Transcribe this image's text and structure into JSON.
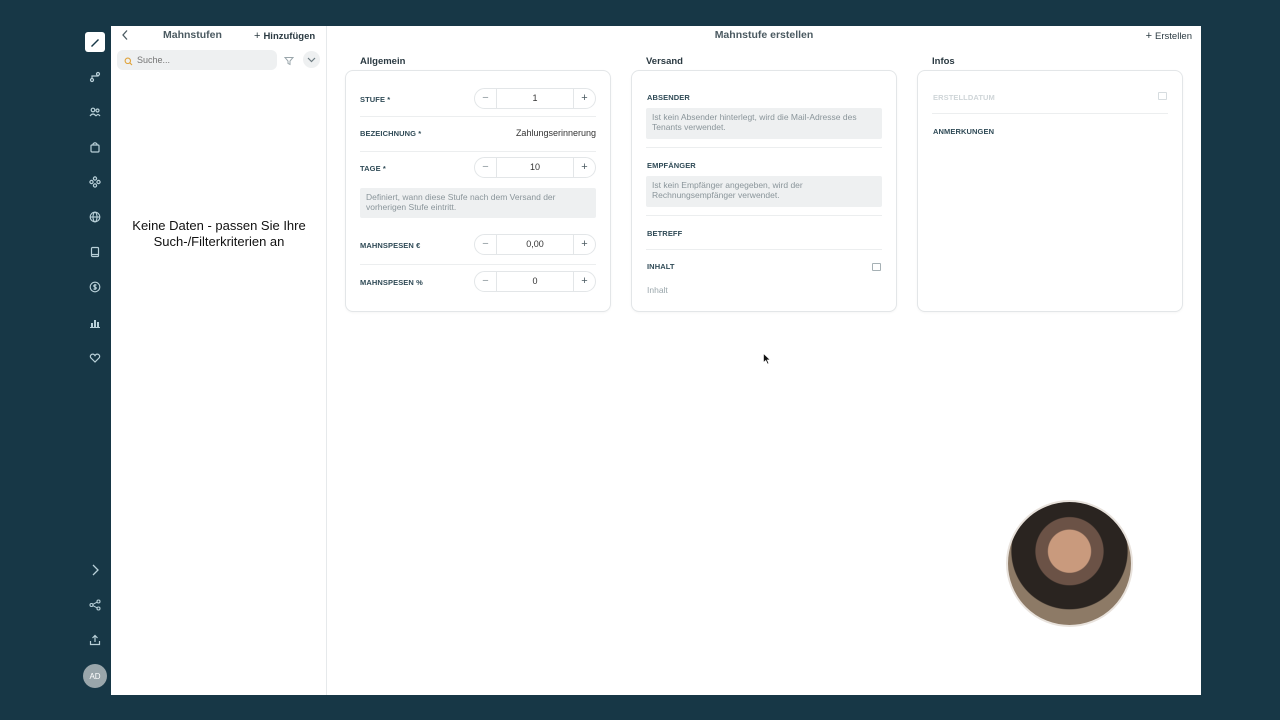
{
  "rail": {
    "avatar_initials": "AD",
    "icons": [
      "pen-icon",
      "pipeline-icon",
      "users-icon",
      "shopping-bag-icon",
      "modules-icon",
      "globe-icon",
      "book-icon",
      "currency-icon",
      "bar-chart-icon",
      "heart-icon",
      "chevron-right-icon",
      "share-icon",
      "upload-icon"
    ]
  },
  "left_pane": {
    "title": "Mahnstufen",
    "add_label": "Hinzufügen",
    "search_placeholder": "Suche...",
    "empty_line1": "Keine Daten - passen Sie Ihre",
    "empty_line2": "Such-/Filterkriterien an"
  },
  "header": {
    "title": "Mahnstufe erstellen",
    "create_label": "Erstellen"
  },
  "allgemein": {
    "section_label": "Allgemein",
    "stufe_label": "STUFE *",
    "stufe_value": "1",
    "bezeichnung_label": "BEZEICHNUNG *",
    "bezeichnung_value": "Zahlungserinnerung",
    "tage_label": "TAGE *",
    "tage_value": "10",
    "tage_hint": "Definiert, wann diese Stufe nach dem Versand der vorherigen Stufe eintritt.",
    "spesen_eur_label": "MAHNSPESEN €",
    "spesen_eur_value": "0,00",
    "spesen_pct_label": "MAHNSPESEN %",
    "spesen_pct_value": "0"
  },
  "versand": {
    "section_label": "Versand",
    "absender_label": "ABSENDER",
    "absender_hint": "Ist kein Absender hinterlegt, wird die Mail-Adresse des Tenants verwendet.",
    "empfaenger_label": "EMPFÄNGER",
    "empfaenger_hint": "Ist kein Empfänger angegeben, wird der Rechnungsempfänger verwendet.",
    "betreff_label": "BETREFF",
    "inhalt_label": "INHALT",
    "inhalt_placeholder": "Inhalt"
  },
  "infos": {
    "section_label": "Infos",
    "erstelldatum_label": "ERSTELLDATUM",
    "anmerkungen_label": "ANMERKUNGEN"
  }
}
